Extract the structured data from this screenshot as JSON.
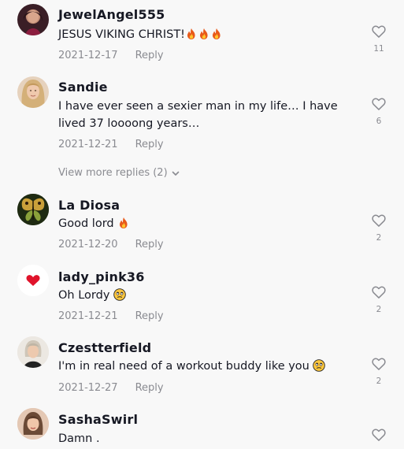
{
  "comments": [
    {
      "username": "JewelAngel555",
      "text": "JESUS VIKING CHRIST!",
      "emojis": [
        "fire",
        "fire",
        "fire"
      ],
      "date": "2021-12-17",
      "reply_label": "Reply",
      "likes": "11",
      "avatar_icon": "avatar-dark-hair"
    },
    {
      "username": "Sandie",
      "text": "I have ever seen a sexier man in my life… I have lived 37 loooong years…",
      "emojis": [],
      "date": "2021-12-21",
      "reply_label": "Reply",
      "likes": "6",
      "avatar_icon": "avatar-blonde"
    },
    {
      "username": "La Diosa",
      "text": "Good lord",
      "emojis": [
        "fire"
      ],
      "date": "2021-12-20",
      "reply_label": "Reply",
      "likes": "2",
      "avatar_icon": "avatar-butterfly"
    },
    {
      "username": "lady_pink36",
      "text": "Oh Lordy",
      "emojis": [
        "face-rolling-eyes"
      ],
      "date": "2021-12-21",
      "reply_label": "Reply",
      "likes": "2",
      "avatar_icon": "avatar-red-heart"
    },
    {
      "username": "Czestterfield",
      "text": "I'm in real need of a workout buddy like you",
      "emojis": [
        "face-rolling-eyes"
      ],
      "date": "2021-12-27",
      "reply_label": "Reply",
      "likes": "2",
      "avatar_icon": "avatar-grey-hair"
    },
    {
      "username": "SashaSwirl",
      "text": "Damn .",
      "emojis": [],
      "date": "",
      "reply_label": "",
      "likes": "",
      "avatar_icon": "avatar-portrait"
    }
  ],
  "view_more_replies": "View more replies (2)",
  "colors": {
    "background": "#f8f8f8",
    "text": "#161823",
    "muted": "#8a8b91",
    "heart_outline": "#8a8b91"
  }
}
